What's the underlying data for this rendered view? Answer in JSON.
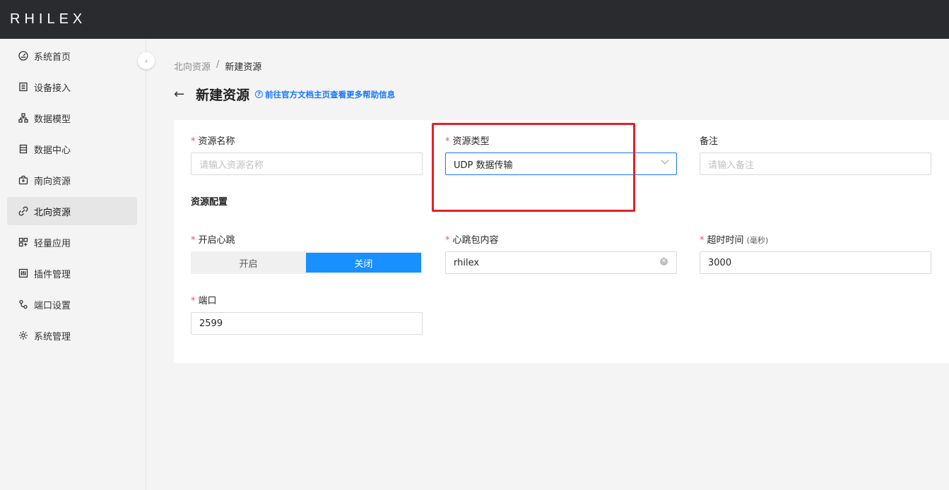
{
  "app": {
    "logo": "RHILEX"
  },
  "sidebar": {
    "items": [
      {
        "label": "系统首页",
        "icon": "dashboard-icon"
      },
      {
        "label": "设备接入",
        "icon": "device-icon"
      },
      {
        "label": "数据模型",
        "icon": "hierarchy-icon"
      },
      {
        "label": "数据中心",
        "icon": "database-icon"
      },
      {
        "label": "南向资源",
        "icon": "upload-box-icon"
      },
      {
        "label": "北向资源",
        "icon": "link-icon",
        "active": true
      },
      {
        "label": "轻量应用",
        "icon": "apps-icon"
      },
      {
        "label": "插件管理",
        "icon": "sliders-icon"
      },
      {
        "label": "端口设置",
        "icon": "port-icon"
      },
      {
        "label": "系统管理",
        "icon": "gear-icon"
      }
    ]
  },
  "breadcrumb": {
    "parent": "北向资源",
    "separator": "/",
    "current": "新建资源"
  },
  "page": {
    "title": "新建资源",
    "help_icon": "?",
    "help_link": "前往官方文档主页查看更多帮助信息"
  },
  "form": {
    "name": {
      "required_mark": "*",
      "label": "资源名称",
      "placeholder": "请输入资源名称"
    },
    "type": {
      "required_mark": "*",
      "label": "资源类型",
      "value": "UDP 数据传输"
    },
    "remark": {
      "label": "备注",
      "placeholder": "请输入备注"
    },
    "config_section_title": "资源配置",
    "heartbeat": {
      "required_mark": "*",
      "label": "开启心跳",
      "option_on": "开启",
      "option_off": "关闭",
      "selected": "关闭"
    },
    "heartbeat_content": {
      "required_mark": "*",
      "label": "心跳包内容",
      "value": "rhilex"
    },
    "timeout": {
      "required_mark": "*",
      "label": "超时时间",
      "unit": "(毫秒)",
      "value": "3000"
    },
    "port": {
      "required_mark": "*",
      "label": "端口",
      "value": "2599"
    }
  },
  "colors": {
    "accent": "#1890ff",
    "highlight": "#e3212b",
    "topbar": "#2a2b2e"
  }
}
